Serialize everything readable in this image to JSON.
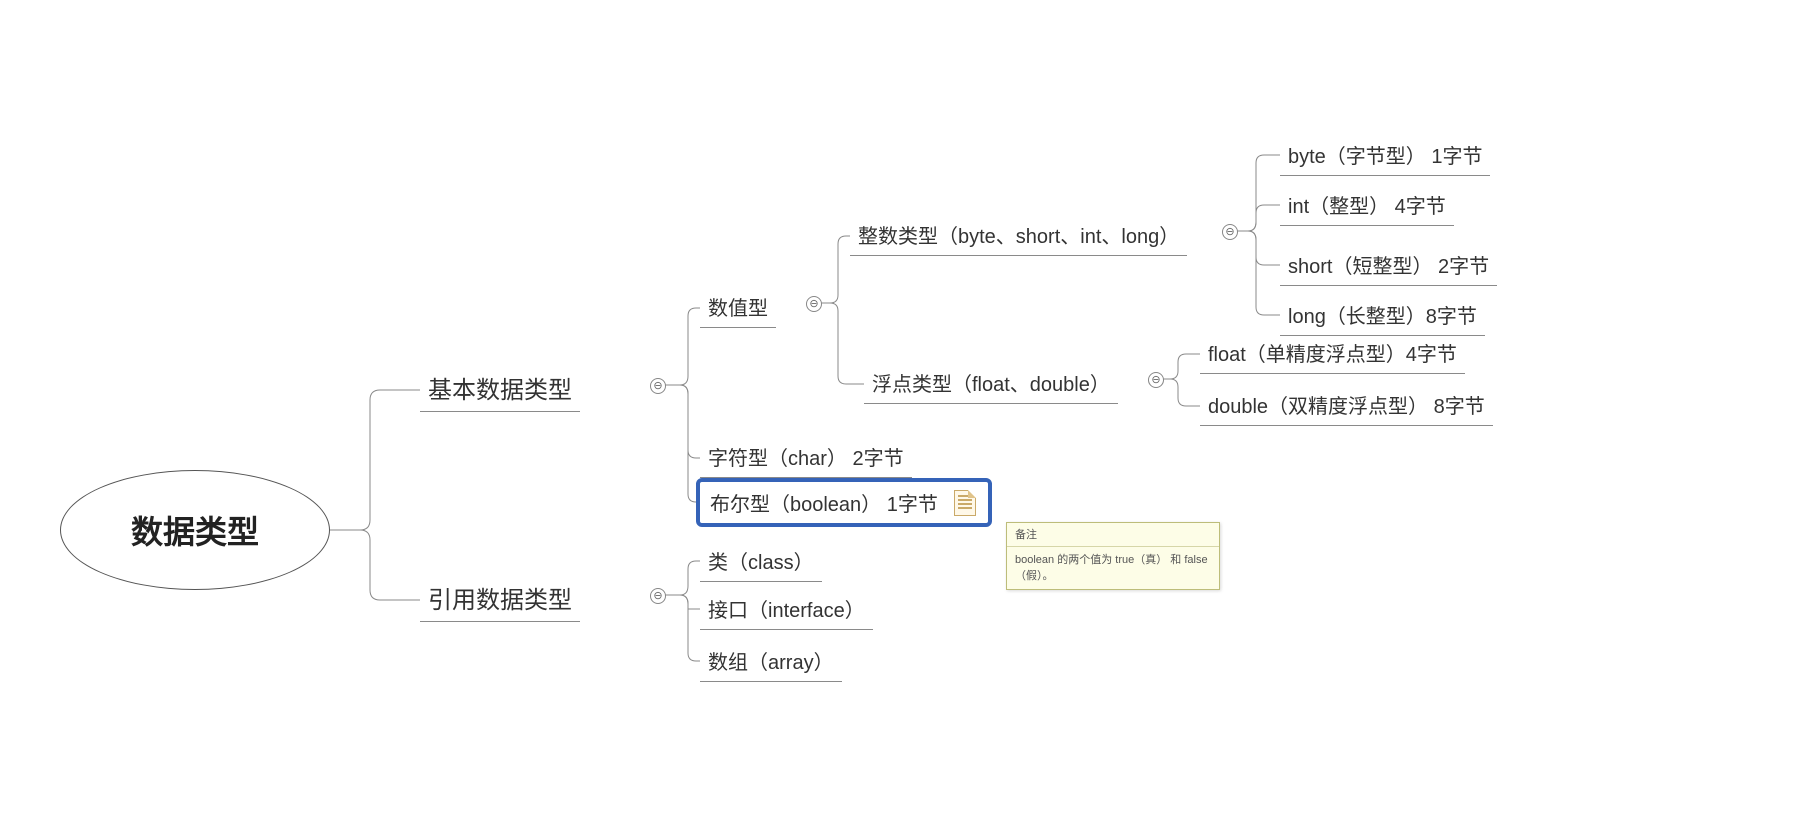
{
  "root": {
    "label": "数据类型"
  },
  "basic": {
    "label": "基本数据类型",
    "numeric": {
      "label": "数值型",
      "integer": {
        "label": "整数类型（byte、short、int、long）",
        "byte": "byte（字节型） 1字节",
        "int": "int（整型）    4字节",
        "short": "short（短整型） 2字节",
        "long": "long（长整型）8字节"
      },
      "float": {
        "label": "浮点类型（float、double）",
        "float": "float（单精度浮点型）4字节",
        "double": "double（双精度浮点型） 8字节"
      }
    },
    "char": "字符型（char）  2字节",
    "boolean": "布尔型（boolean） 1字节"
  },
  "reference": {
    "label": "引用数据类型",
    "class": "类（class）",
    "interface": "接口（interface）",
    "array": "数组（array）"
  },
  "tooltip": {
    "title": "备注",
    "body": "boolean 的两个值为 true（真） 和 false（假）。"
  },
  "toggle_glyph": "⊖"
}
